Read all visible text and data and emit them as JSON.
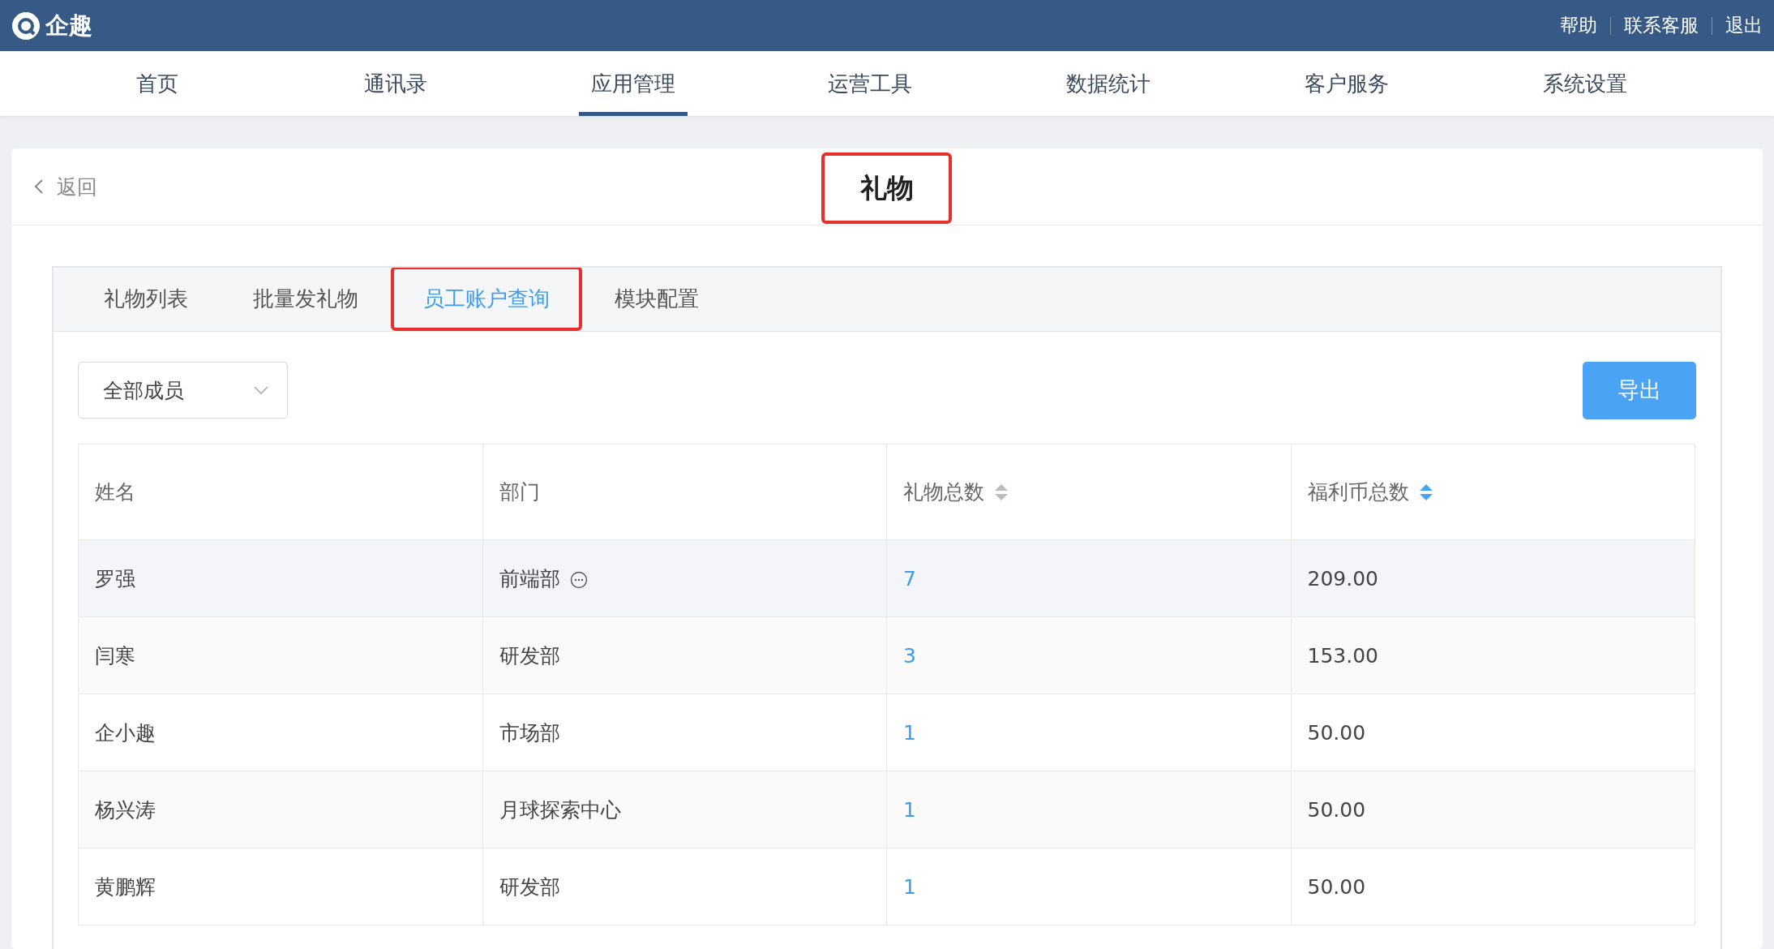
{
  "brand": {
    "name": "企趣"
  },
  "top_links": [
    "帮助",
    "联系客服",
    "退出"
  ],
  "nav": [
    {
      "label": "首页",
      "selected": false
    },
    {
      "label": "通讯录",
      "selected": false
    },
    {
      "label": "应用管理",
      "selected": true
    },
    {
      "label": "运营工具",
      "selected": false
    },
    {
      "label": "数据统计",
      "selected": false
    },
    {
      "label": "客户服务",
      "selected": false
    },
    {
      "label": "系统设置",
      "selected": false
    }
  ],
  "page": {
    "back": "返回",
    "title": "礼物",
    "title_highlighted": true
  },
  "tabs": [
    {
      "label": "礼物列表",
      "selected": false,
      "highlighted": false
    },
    {
      "label": "批量发礼物",
      "selected": false,
      "highlighted": false
    },
    {
      "label": "员工账户查询",
      "selected": true,
      "highlighted": true
    },
    {
      "label": "模块配置",
      "selected": false,
      "highlighted": false
    }
  ],
  "filter": {
    "value": "全部成员"
  },
  "export_button": "导出",
  "table": {
    "columns": [
      {
        "label": "姓名"
      },
      {
        "label": "部门"
      },
      {
        "label": "礼物总数",
        "sortable": true,
        "sort_active": false
      },
      {
        "label": "福利币总数",
        "sortable": true,
        "sort_active": true
      }
    ],
    "rows": [
      {
        "name": "罗强",
        "department": "前端部",
        "more": true,
        "gifts": "7",
        "coins": "209.00",
        "highlighted": true
      },
      {
        "name": "闫寒",
        "department": "研发部",
        "more": false,
        "gifts": "3",
        "coins": "153.00",
        "highlighted": false
      },
      {
        "name": "企小趣",
        "department": "市场部",
        "more": false,
        "gifts": "1",
        "coins": "50.00",
        "highlighted": false
      },
      {
        "name": "杨兴涛",
        "department": "月球探索中心",
        "more": false,
        "gifts": "1",
        "coins": "50.00",
        "highlighted": false
      },
      {
        "name": "黄鹏辉",
        "department": "研发部",
        "more": false,
        "gifts": "1",
        "coins": "50.00",
        "highlighted": false
      }
    ]
  }
}
